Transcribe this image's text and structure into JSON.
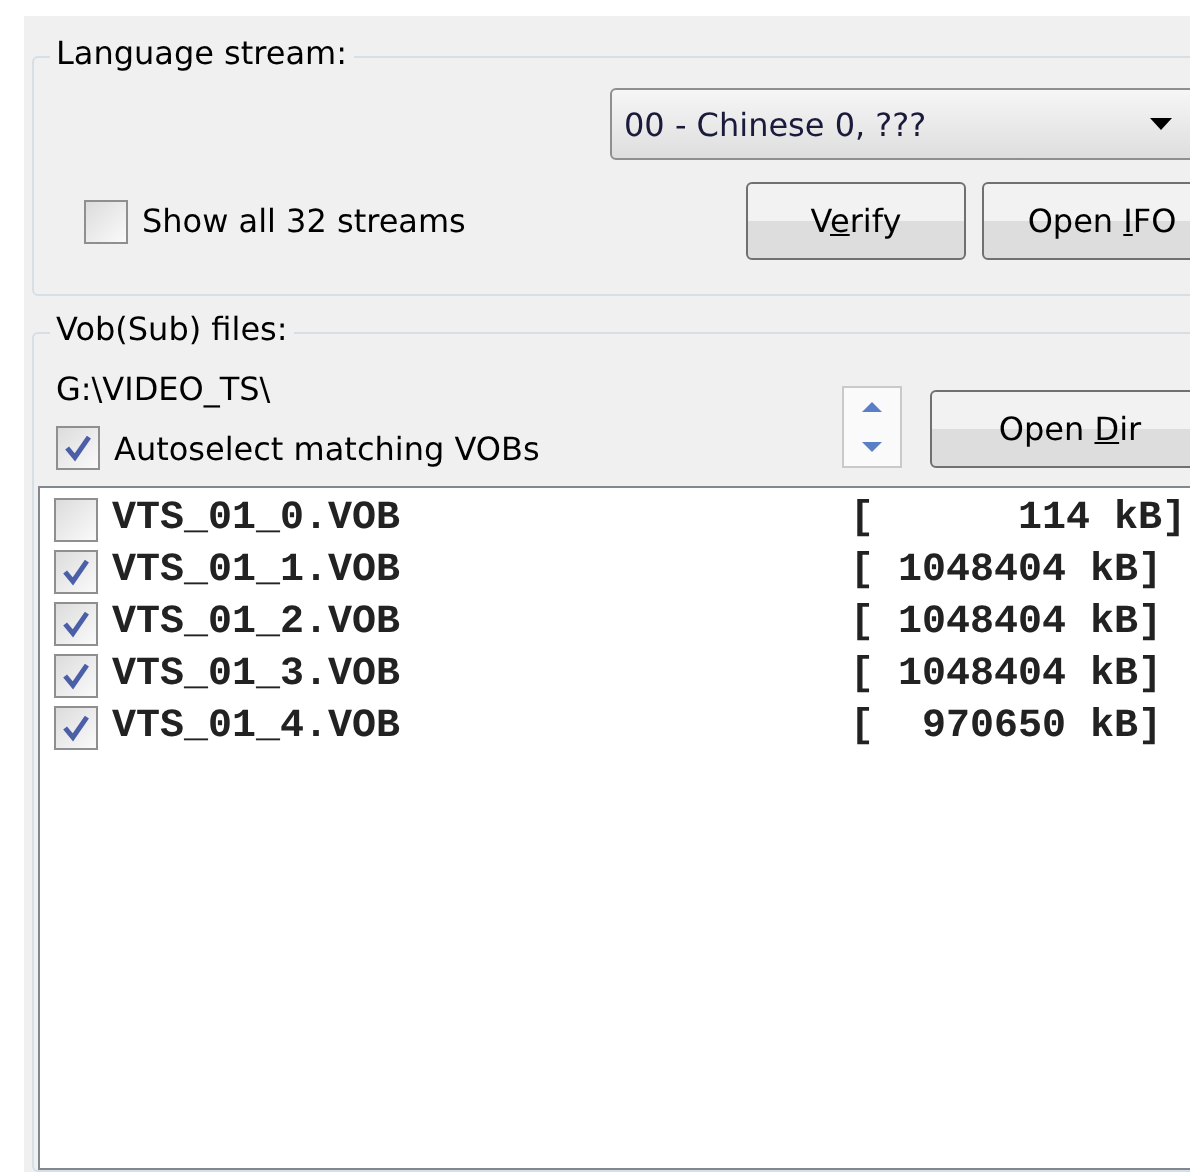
{
  "language_stream": {
    "title": "Language stream:",
    "dropdown": {
      "value": "00 - Chinese 0, ???"
    },
    "show_all": {
      "label": "Show all 32 streams",
      "checked": false
    },
    "buttons": [
      {
        "label_before": "V",
        "access_key": "e",
        "label_after": "rify"
      },
      {
        "label_before": "Open ",
        "access_key": "I",
        "label_after": "FO"
      }
    ]
  },
  "vob_files": {
    "title": "Vob(Sub) files:",
    "path": "G:\\VIDEO_TS\\",
    "autoselect": {
      "label": "Autoselect matching VOBs",
      "checked": true
    },
    "open_dir": {
      "label_before": "Open ",
      "access_key": "D",
      "label_after": "ir"
    },
    "files": [
      {
        "name": "VTS_01_0.VOB",
        "size": "[      114 kB]",
        "checked": false
      },
      {
        "name": "VTS_01_1.VOB",
        "size": "[ 1048404 kB]",
        "checked": true
      },
      {
        "name": "VTS_01_2.VOB",
        "size": "[ 1048404 kB]",
        "checked": true
      },
      {
        "name": "VTS_01_3.VOB",
        "size": "[ 1048404 kB]",
        "checked": true
      },
      {
        "name": "VTS_01_4.VOB",
        "size": "[  970650 kB]",
        "checked": true
      }
    ]
  }
}
